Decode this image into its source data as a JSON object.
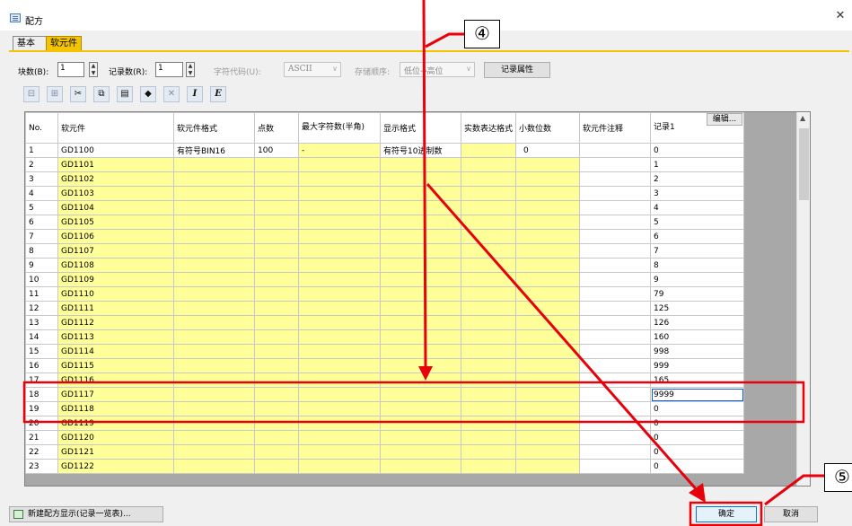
{
  "window": {
    "title": "配方",
    "close_icon": "✕"
  },
  "tabs": [
    {
      "label": "基本"
    },
    {
      "label": "软元件"
    }
  ],
  "controls": {
    "blocks_label": "块数(B):",
    "blocks_value": "1",
    "records_label": "记录数(R):",
    "records_value": "1",
    "charcode_label": "字符代码(U):",
    "charcode_value": "ASCII",
    "order_label": "存储顺序:",
    "order_value": "低位→高位",
    "record_attr_button": "记录属性"
  },
  "toolbar_icons": [
    "insert-row-icon",
    "delete-row-icon",
    "cut-icon",
    "copy-icon",
    "paste-icon",
    "erase-icon",
    "delete-icon",
    "import-icon",
    "export-icon"
  ],
  "table": {
    "headers": {
      "no": "No.",
      "device": "软元件",
      "format": "软元件格式",
      "points": "点数",
      "maxchars": "最大字符数(半角)",
      "display": "显示格式",
      "realfmt": "实数表达格式",
      "decimal": "小数位数",
      "comment": "软元件注释",
      "record1": "记录1",
      "edit_button": "编辑..."
    },
    "first_row": {
      "no": "1",
      "device": "GD1100",
      "format": "有符号BIN16",
      "points": "100",
      "maxchars": "-",
      "display": "有符号10进制数",
      "decimal": "0",
      "record1": "0"
    },
    "rows": [
      {
        "no": "2",
        "device": "GD1101",
        "record1": "1"
      },
      {
        "no": "3",
        "device": "GD1102",
        "record1": "2"
      },
      {
        "no": "4",
        "device": "GD1103",
        "record1": "3"
      },
      {
        "no": "5",
        "device": "GD1104",
        "record1": "4"
      },
      {
        "no": "6",
        "device": "GD1105",
        "record1": "5"
      },
      {
        "no": "7",
        "device": "GD1106",
        "record1": "6"
      },
      {
        "no": "8",
        "device": "GD1107",
        "record1": "7"
      },
      {
        "no": "9",
        "device": "GD1108",
        "record1": "8"
      },
      {
        "no": "10",
        "device": "GD1109",
        "record1": "9"
      },
      {
        "no": "11",
        "device": "GD1110",
        "record1": "79"
      },
      {
        "no": "12",
        "device": "GD1111",
        "record1": "125"
      },
      {
        "no": "13",
        "device": "GD1112",
        "record1": "126"
      },
      {
        "no": "14",
        "device": "GD1113",
        "record1": "160"
      },
      {
        "no": "15",
        "device": "GD1114",
        "record1": "998"
      },
      {
        "no": "16",
        "device": "GD1115",
        "record1": "999"
      },
      {
        "no": "17",
        "device": "GD1116",
        "record1": "165"
      },
      {
        "no": "18",
        "device": "GD1117",
        "record1": "9999"
      },
      {
        "no": "19",
        "device": "GD1118",
        "record1": "0"
      },
      {
        "no": "20",
        "device": "GD1119",
        "record1": "0"
      },
      {
        "no": "21",
        "device": "GD1120",
        "record1": "0"
      },
      {
        "no": "22",
        "device": "GD1121",
        "record1": "0"
      },
      {
        "no": "23",
        "device": "GD1122",
        "record1": "0"
      }
    ]
  },
  "footer": {
    "new_recipe_button": "新建配方显示(记录一览表)...",
    "ok_button": "确定",
    "cancel_button": "取消"
  },
  "annotations": {
    "callout4": "④",
    "callout5": "⑤",
    "arrow_color": "#e8000b"
  }
}
